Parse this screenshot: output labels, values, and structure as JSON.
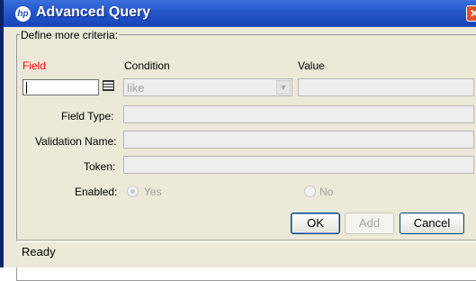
{
  "window": {
    "title": "Advanced Query",
    "title_icon": "hp-logo-icon",
    "close_icon": "close-icon"
  },
  "group": {
    "legend": "Define more criteria:"
  },
  "columns": {
    "field": "Field",
    "condition": "Condition",
    "value": "Value"
  },
  "criteria": {
    "field_value": "",
    "condition_selected": "like",
    "value_value": ""
  },
  "labels": {
    "field_type": "Field Type:",
    "validation_name": "Validation Name:",
    "token": "Token:",
    "enabled": "Enabled:"
  },
  "enabled": {
    "yes_label": "Yes",
    "no_label": "No",
    "selected": "Yes"
  },
  "buttons": {
    "ok": "OK",
    "add": "Add",
    "cancel": "Cancel"
  },
  "status": {
    "text": "Ready"
  },
  "colors": {
    "titlebar": "#2456c9",
    "required_label": "#ff0000",
    "window_bg": "#ece9d8"
  }
}
